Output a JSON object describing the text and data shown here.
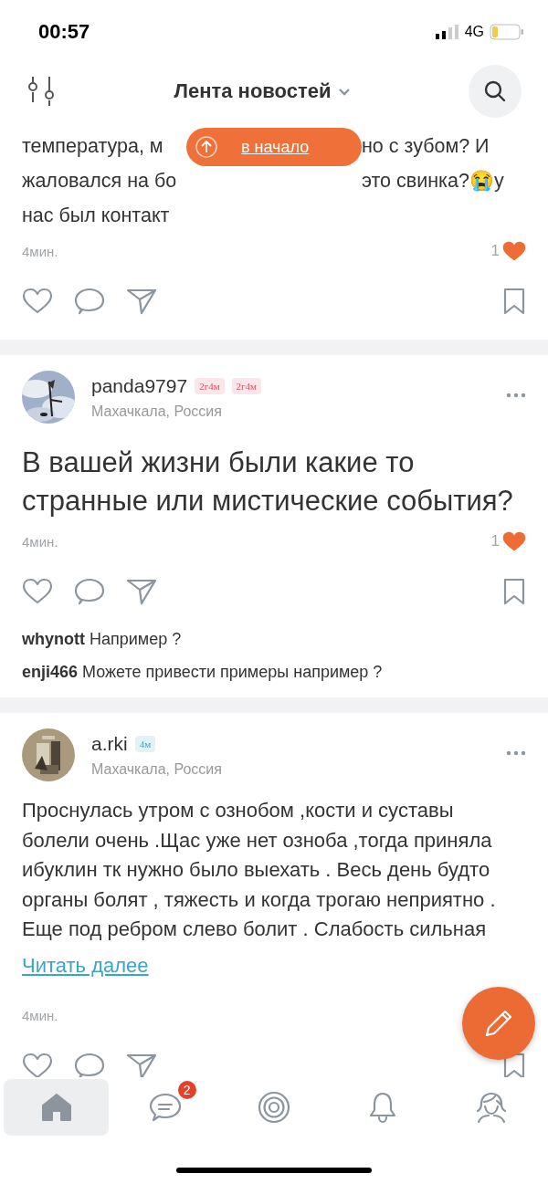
{
  "status_bar": {
    "time": "00:57",
    "network": "4G"
  },
  "header": {
    "title": "Лента новостей"
  },
  "scroll_top_button": {
    "label": "в начало"
  },
  "posts": [
    {
      "kind": "partial",
      "lines": [
        {
          "left": "температура, м",
          "right": "но с зубом? И"
        },
        {
          "left": "жаловался на бо",
          "right": "это свинка?😭у"
        },
        {
          "left": "нас был контакт"
        }
      ],
      "time": "4мин.",
      "likes": "1"
    },
    {
      "kind": "question",
      "author": "panda9797",
      "badges": [
        {
          "label": "2г4м",
          "color": "#e0506a"
        },
        {
          "label": "2г4м",
          "color": "#e0506a"
        }
      ],
      "location": "Махачкала, Россия",
      "text": "В вашей жизни были какие то странные или мистические события?",
      "time": "4мин.",
      "likes": "1",
      "comments": [
        {
          "user": "whynott",
          "text": "Например ?"
        },
        {
          "user": "enji466",
          "text": "Можете привести примеры например ?"
        }
      ]
    },
    {
      "kind": "text",
      "author": "a.rki",
      "badges": [
        {
          "label": "4м",
          "color": "#3aa6c4"
        }
      ],
      "location": "Махачкала, Россия",
      "text": "Проснулась утром  с ознобом ,кости и суставы болели очень .Щас уже нет озноба ,тогда приняла ибуклин тк нужно было выехать . Весь день будто органы болят , тяжесть и когда трогаю неприятно . Еще под ребром слево болит . Слабость сильная",
      "read_more": "Читать далее",
      "time": "4мин."
    }
  ],
  "tab_bar": [
    {
      "kind": "home",
      "selected": true
    },
    {
      "kind": "chat",
      "selected": false,
      "badge": "2"
    },
    {
      "kind": "target",
      "selected": false
    },
    {
      "kind": "bell",
      "selected": false
    },
    {
      "kind": "profile",
      "selected": false
    }
  ]
}
